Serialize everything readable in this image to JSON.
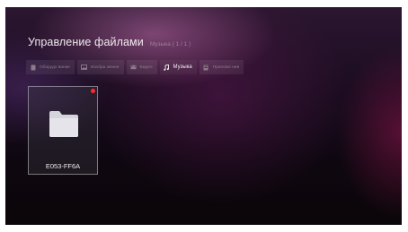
{
  "header": {
    "title": "Управление файлами",
    "subtitle": "Музыка ( 1 / 1 )"
  },
  "tabs": [
    {
      "label": "Оборудо вание",
      "icon": "device-icon",
      "active": false
    },
    {
      "label": "Изобра жение",
      "icon": "image-icon",
      "active": false
    },
    {
      "label": "Видео",
      "icon": "video-icon",
      "active": false
    },
    {
      "label": "Музыка",
      "icon": "music-note-icon",
      "active": true
    },
    {
      "label": "Приложе ния",
      "icon": "apps-icon",
      "active": false
    }
  ],
  "items": [
    {
      "name": "E053-FF6A",
      "icon": "folder-icon",
      "badge_color": "#ff2a2a"
    }
  ],
  "colors": {
    "badge": "#ff2a2a",
    "background": "#1a0c1f"
  }
}
